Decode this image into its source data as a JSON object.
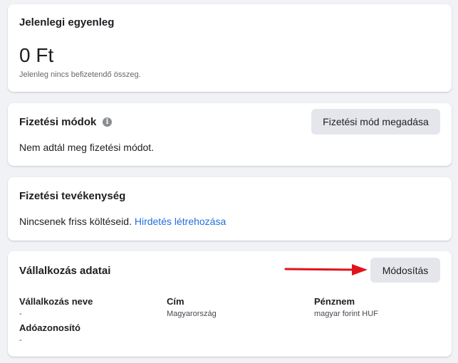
{
  "balance": {
    "title": "Jelenlegi egyenleg",
    "amount": "0 Ft",
    "note": "Jelenleg nincs befizetendő összeg."
  },
  "payment_methods": {
    "title": "Fizetési módok",
    "info_icon": "info-icon",
    "add_button": "Fizetési mód megadása",
    "empty_text": "Nem adtál meg fizetési módot."
  },
  "payment_activity": {
    "title": "Fizetési tevékenység",
    "empty_text": "Nincsenek friss költéseid.",
    "create_ad_link": "Hirdetés létrehozása"
  },
  "business_info": {
    "title": "Vállalkozás adatai",
    "edit_button": "Módosítás",
    "fields": {
      "name_label": "Vállalkozás neve",
      "name_value": "-",
      "address_label": "Cím",
      "address_value": "Magyarország",
      "currency_label": "Pénznem",
      "currency_value": "magyar forint HUF",
      "tax_id_label": "Adóazonosító",
      "tax_id_value": "-"
    }
  },
  "colors": {
    "link": "#216fdb",
    "annotation_arrow": "#e0141c",
    "button_bg": "#e4e6eb",
    "page_bg": "#f0f2f5"
  }
}
